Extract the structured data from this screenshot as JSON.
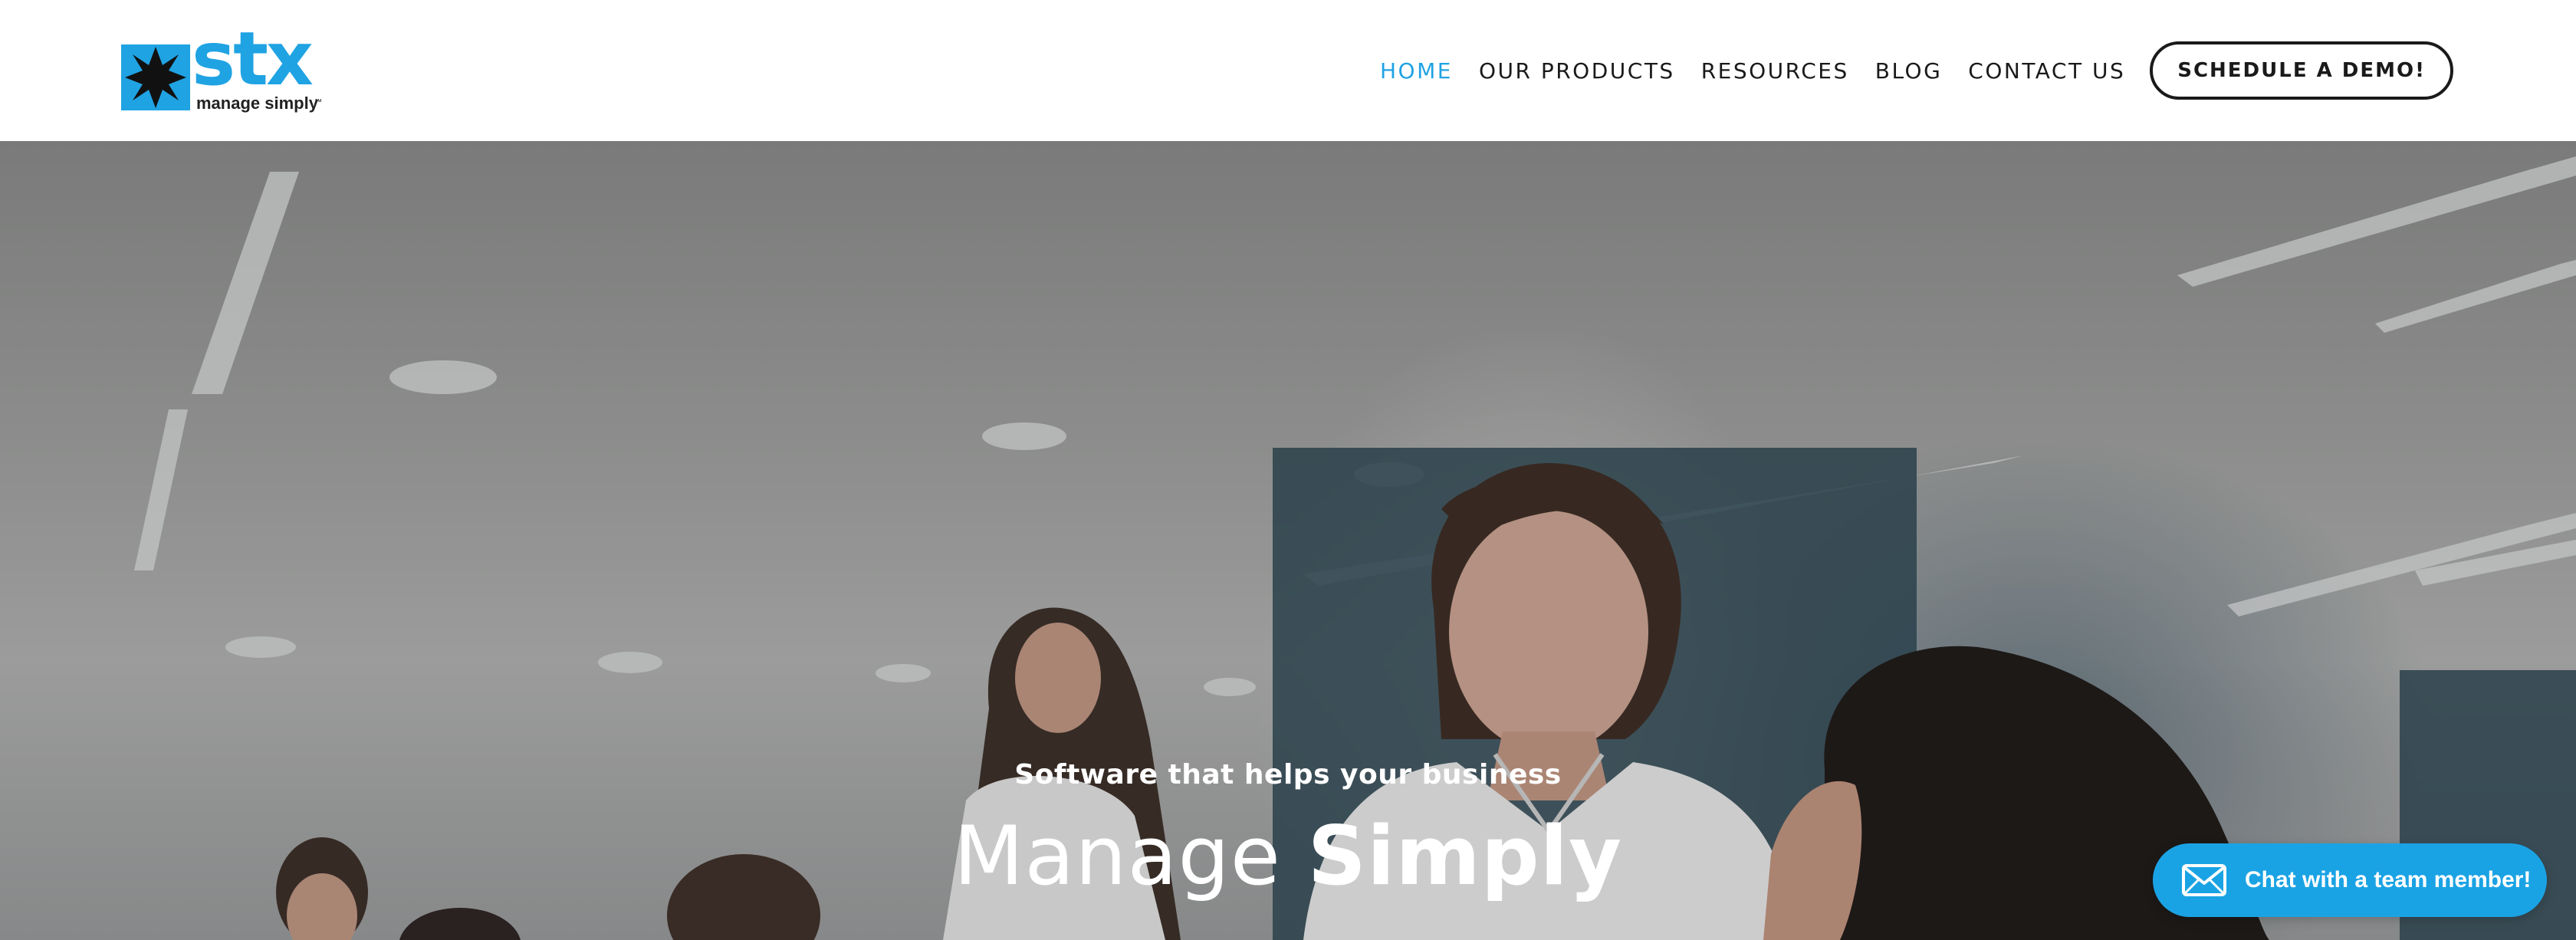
{
  "brand": {
    "name": "stx",
    "tagline": "manage simply",
    "trademark": "™",
    "primary_color": "#1fa3e3",
    "dark_color": "#1a1a1a",
    "icon": "star-logo-icon"
  },
  "nav": {
    "items": [
      {
        "label": "HOME",
        "active": true
      },
      {
        "label": "OUR PRODUCTS",
        "active": false
      },
      {
        "label": "RESOURCES",
        "active": false
      },
      {
        "label": "BLOG",
        "active": false
      },
      {
        "label": "CONTACT US",
        "active": false
      }
    ],
    "cta_label": "SCHEDULE A DEMO!"
  },
  "hero": {
    "subtitle": "Software that helps your business",
    "title_light": "Manage",
    "title_bold": "Simply"
  },
  "chat": {
    "label": "Chat with a team member!",
    "icon": "envelope-icon",
    "color": "#1aa3e4"
  }
}
